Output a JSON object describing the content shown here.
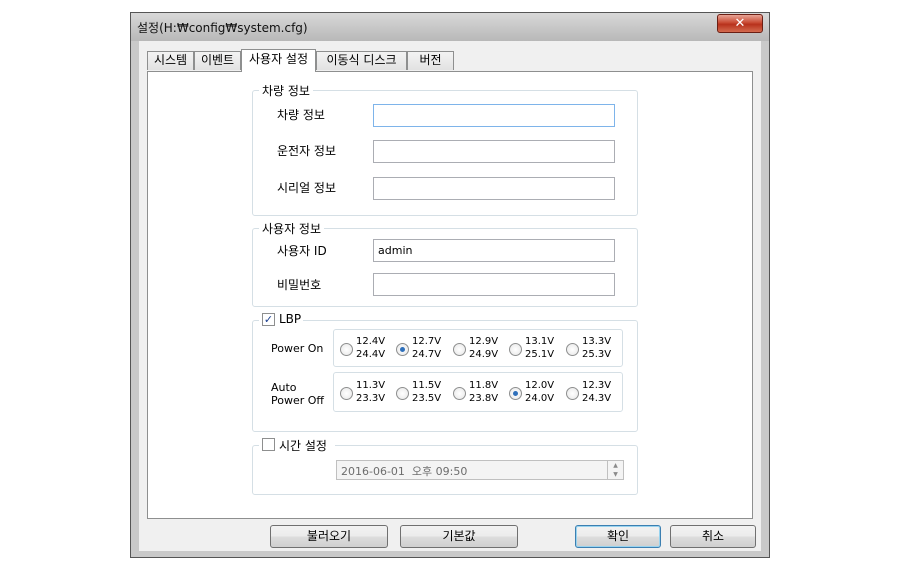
{
  "window": {
    "title": "설정(H:₩config₩system.cfg)"
  },
  "tabs": [
    {
      "label": "시스템"
    },
    {
      "label": "이벤트"
    },
    {
      "label": "사용자 설정"
    },
    {
      "label": "이동식 디스크"
    },
    {
      "label": "버전"
    }
  ],
  "vehicle_group": {
    "title": "차량 정보",
    "fields": [
      {
        "label": "차량 정보",
        "value": ""
      },
      {
        "label": "운전자 정보",
        "value": ""
      },
      {
        "label": "시리얼 정보",
        "value": ""
      }
    ]
  },
  "user_group": {
    "title": "사용자 정보",
    "fields": [
      {
        "label": "사용자 ID",
        "value": "admin"
      },
      {
        "label": "비밀번호",
        "value": ""
      }
    ]
  },
  "lbp": {
    "label": "LBP",
    "checked": true,
    "power_on": {
      "label": "Power On",
      "options": [
        {
          "top": "12.4V",
          "bottom": "24.4V"
        },
        {
          "top": "12.7V",
          "bottom": "24.7V"
        },
        {
          "top": "12.9V",
          "bottom": "24.9V"
        },
        {
          "top": "13.1V",
          "bottom": "25.1V"
        },
        {
          "top": "13.3V",
          "bottom": "25.3V"
        }
      ],
      "selected_index": 1
    },
    "auto_power_off": {
      "label_line1": "Auto",
      "label_line2": "Power Off",
      "options": [
        {
          "top": "11.3V",
          "bottom": "23.3V"
        },
        {
          "top": "11.5V",
          "bottom": "23.5V"
        },
        {
          "top": "11.8V",
          "bottom": "23.8V"
        },
        {
          "top": "12.0V",
          "bottom": "24.0V"
        },
        {
          "top": "12.3V",
          "bottom": "24.3V"
        }
      ],
      "selected_index": 3
    }
  },
  "time_setting": {
    "label": "시간 설정",
    "checked": false,
    "datetime": "2016-06-01  오후 09:50"
  },
  "buttons": {
    "load": "불러오기",
    "default": "기본값",
    "ok": "확인",
    "cancel": "취소"
  },
  "icons": {
    "close": "✕",
    "check": "✓",
    "spin_up": "▲",
    "spin_down": "▼"
  }
}
